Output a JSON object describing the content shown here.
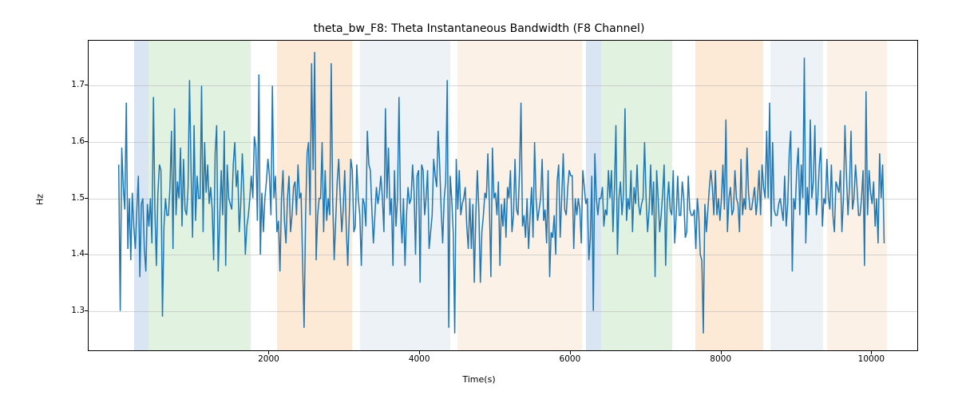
{
  "chart_data": {
    "type": "line",
    "title": "theta_bw_F8: Theta Instantaneous Bandwidth (F8 Channel)",
    "xlabel": "Time(s)",
    "ylabel": "Hz",
    "xlim": [
      -400,
      10600
    ],
    "ylim": [
      1.23,
      1.78
    ],
    "xticks": [
      2000,
      4000,
      6000,
      8000,
      10000
    ],
    "yticks": [
      1.3,
      1.4,
      1.5,
      1.6,
      1.7
    ],
    "bands": [
      {
        "x0": 200,
        "x1": 400,
        "color": "#6699cc"
      },
      {
        "x0": 400,
        "x1": 1750,
        "color": "#88cc88"
      },
      {
        "x0": 2100,
        "x1": 3100,
        "color": "#f5a65b"
      },
      {
        "x0": 3200,
        "x1": 4400,
        "color": "#b8cde0"
      },
      {
        "x0": 4500,
        "x1": 6150,
        "color": "#f5c99b"
      },
      {
        "x0": 6200,
        "x1": 6400,
        "color": "#6699cc"
      },
      {
        "x0": 6400,
        "x1": 7350,
        "color": "#88cc88"
      },
      {
        "x0": 7650,
        "x1": 8550,
        "color": "#f5a65b"
      },
      {
        "x0": 8650,
        "x1": 9350,
        "color": "#b8cde0"
      },
      {
        "x0": 9400,
        "x1": 10200,
        "color": "#f5c99b"
      }
    ],
    "series": [
      {
        "name": "theta_bw_F8",
        "color": "#1f77b4",
        "x_start": 0,
        "x_step": 20,
        "values": [
          1.56,
          1.3,
          1.59,
          1.52,
          1.48,
          1.67,
          1.41,
          1.5,
          1.39,
          1.51,
          1.45,
          1.41,
          1.48,
          1.54,
          1.36,
          1.49,
          1.5,
          1.41,
          1.37,
          1.49,
          1.45,
          1.5,
          1.42,
          1.68,
          1.48,
          1.38,
          1.51,
          1.56,
          1.55,
          1.29,
          1.45,
          1.5,
          1.47,
          1.47,
          1.52,
          1.62,
          1.41,
          1.66,
          1.47,
          1.53,
          1.5,
          1.59,
          1.45,
          1.57,
          1.48,
          1.47,
          1.52,
          1.71,
          1.55,
          1.43,
          1.63,
          1.46,
          1.54,
          1.5,
          1.5,
          1.7,
          1.44,
          1.6,
          1.51,
          1.56,
          1.49,
          1.52,
          1.48,
          1.39,
          1.58,
          1.63,
          1.37,
          1.46,
          1.55,
          1.47,
          1.62,
          1.38,
          1.56,
          1.5,
          1.49,
          1.48,
          1.56,
          1.6,
          1.52,
          1.55,
          1.44,
          1.49,
          1.58,
          1.51,
          1.4,
          1.45,
          1.47,
          1.5,
          1.54,
          1.5,
          1.61,
          1.59,
          1.46,
          1.72,
          1.4,
          1.51,
          1.44,
          1.5,
          1.53,
          1.57,
          1.54,
          1.47,
          1.7,
          1.5,
          1.54,
          1.44,
          1.46,
          1.37,
          1.5,
          1.55,
          1.46,
          1.42,
          1.5,
          1.54,
          1.44,
          1.47,
          1.52,
          1.53,
          1.47,
          1.56,
          1.5,
          1.51,
          1.39,
          1.27,
          1.47,
          1.58,
          1.6,
          1.47,
          1.74,
          1.55,
          1.76,
          1.39,
          1.47,
          1.5,
          1.5,
          1.6,
          1.44,
          1.55,
          1.46,
          1.5,
          1.47,
          1.74,
          1.5,
          1.39,
          1.46,
          1.53,
          1.57,
          1.5,
          1.44,
          1.48,
          1.55,
          1.45,
          1.38,
          1.47,
          1.57,
          1.55,
          1.44,
          1.45,
          1.56,
          1.5,
          1.47,
          1.38,
          1.5,
          1.49,
          1.45,
          1.62,
          1.56,
          1.55,
          1.48,
          1.42,
          1.47,
          1.52,
          1.49,
          1.51,
          1.54,
          1.5,
          1.44,
          1.66,
          1.5,
          1.59,
          1.47,
          1.5,
          1.38,
          1.55,
          1.45,
          1.5,
          1.68,
          1.48,
          1.42,
          1.5,
          1.38,
          1.47,
          1.52,
          1.49,
          1.5,
          1.56,
          1.51,
          1.4,
          1.54,
          1.55,
          1.35,
          1.56,
          1.55,
          1.47,
          1.5,
          1.55,
          1.41,
          1.44,
          1.47,
          1.57,
          1.54,
          1.52,
          1.62,
          1.56,
          1.48,
          1.42,
          1.5,
          1.53,
          1.71,
          1.27,
          1.54,
          1.5,
          1.44,
          1.26,
          1.57,
          1.48,
          1.55,
          1.47,
          1.49,
          1.5,
          1.52,
          1.45,
          1.41,
          1.5,
          1.41,
          1.49,
          1.35,
          1.47,
          1.55,
          1.48,
          1.35,
          1.44,
          1.47,
          1.51,
          1.5,
          1.58,
          1.49,
          1.36,
          1.59,
          1.5,
          1.51,
          1.47,
          1.53,
          1.38,
          1.49,
          1.45,
          1.5,
          1.43,
          1.52,
          1.5,
          1.55,
          1.44,
          1.47,
          1.57,
          1.48,
          1.47,
          1.55,
          1.67,
          1.45,
          1.47,
          1.43,
          1.5,
          1.41,
          1.47,
          1.52,
          1.43,
          1.6,
          1.5,
          1.46,
          1.48,
          1.5,
          1.57,
          1.46,
          1.48,
          1.42,
          1.55,
          1.36,
          1.44,
          1.43,
          1.47,
          1.4,
          1.53,
          1.56,
          1.43,
          1.5,
          1.58,
          1.48,
          1.47,
          1.52,
          1.55,
          1.54,
          1.54,
          1.41,
          1.5,
          1.47,
          1.5,
          1.48,
          1.42,
          1.55,
          1.52,
          1.49,
          1.5,
          1.39,
          1.43,
          1.54,
          1.3,
          1.58,
          1.5,
          1.47,
          1.5,
          1.5,
          1.52,
          1.45,
          1.48,
          1.47,
          1.55,
          1.5,
          1.55,
          1.44,
          1.52,
          1.63,
          1.4,
          1.5,
          1.53,
          1.47,
          1.51,
          1.66,
          1.46,
          1.5,
          1.48,
          1.55,
          1.44,
          1.52,
          1.49,
          1.56,
          1.49,
          1.47,
          1.49,
          1.5,
          1.6,
          1.5,
          1.44,
          1.48,
          1.56,
          1.47,
          1.53,
          1.36,
          1.55,
          1.5,
          1.44,
          1.47,
          1.51,
          1.56,
          1.38,
          1.49,
          1.53,
          1.48,
          1.47,
          1.55,
          1.42,
          1.47,
          1.54,
          1.47,
          1.47,
          1.53,
          1.5,
          1.43,
          1.44,
          1.54,
          1.48,
          1.47,
          1.47,
          1.48,
          1.41,
          1.5,
          1.47,
          1.4,
          1.39,
          1.26,
          1.49,
          1.44,
          1.48,
          1.52,
          1.55,
          1.52,
          1.47,
          1.55,
          1.47,
          1.5,
          1.46,
          1.5,
          1.56,
          1.48,
          1.64,
          1.44,
          1.5,
          1.52,
          1.47,
          1.48,
          1.55,
          1.5,
          1.49,
          1.44,
          1.57,
          1.47,
          1.5,
          1.48,
          1.59,
          1.51,
          1.48,
          1.48,
          1.5,
          1.52,
          1.47,
          1.5,
          1.55,
          1.47,
          1.56,
          1.52,
          1.5,
          1.62,
          1.5,
          1.67,
          1.45,
          1.6,
          1.48,
          1.47,
          1.47,
          1.49,
          1.5,
          1.48,
          1.46,
          1.54,
          1.45,
          1.49,
          1.58,
          1.62,
          1.37,
          1.5,
          1.48,
          1.55,
          1.59,
          1.47,
          1.56,
          1.5,
          1.75,
          1.42,
          1.52,
          1.47,
          1.64,
          1.5,
          1.53,
          1.63,
          1.47,
          1.5,
          1.56,
          1.59,
          1.45,
          1.5,
          1.49,
          1.57,
          1.5,
          1.48,
          1.56,
          1.47,
          1.44,
          1.53,
          1.52,
          1.51,
          1.55,
          1.44,
          1.5,
          1.63,
          1.54,
          1.47,
          1.52,
          1.62,
          1.48,
          1.5,
          1.56,
          1.52,
          1.47,
          1.47,
          1.5,
          1.55,
          1.38,
          1.69,
          1.47,
          1.55,
          1.51,
          1.49,
          1.53,
          1.45,
          1.5,
          1.42,
          1.58,
          1.5,
          1.56,
          1.42
        ]
      }
    ]
  }
}
